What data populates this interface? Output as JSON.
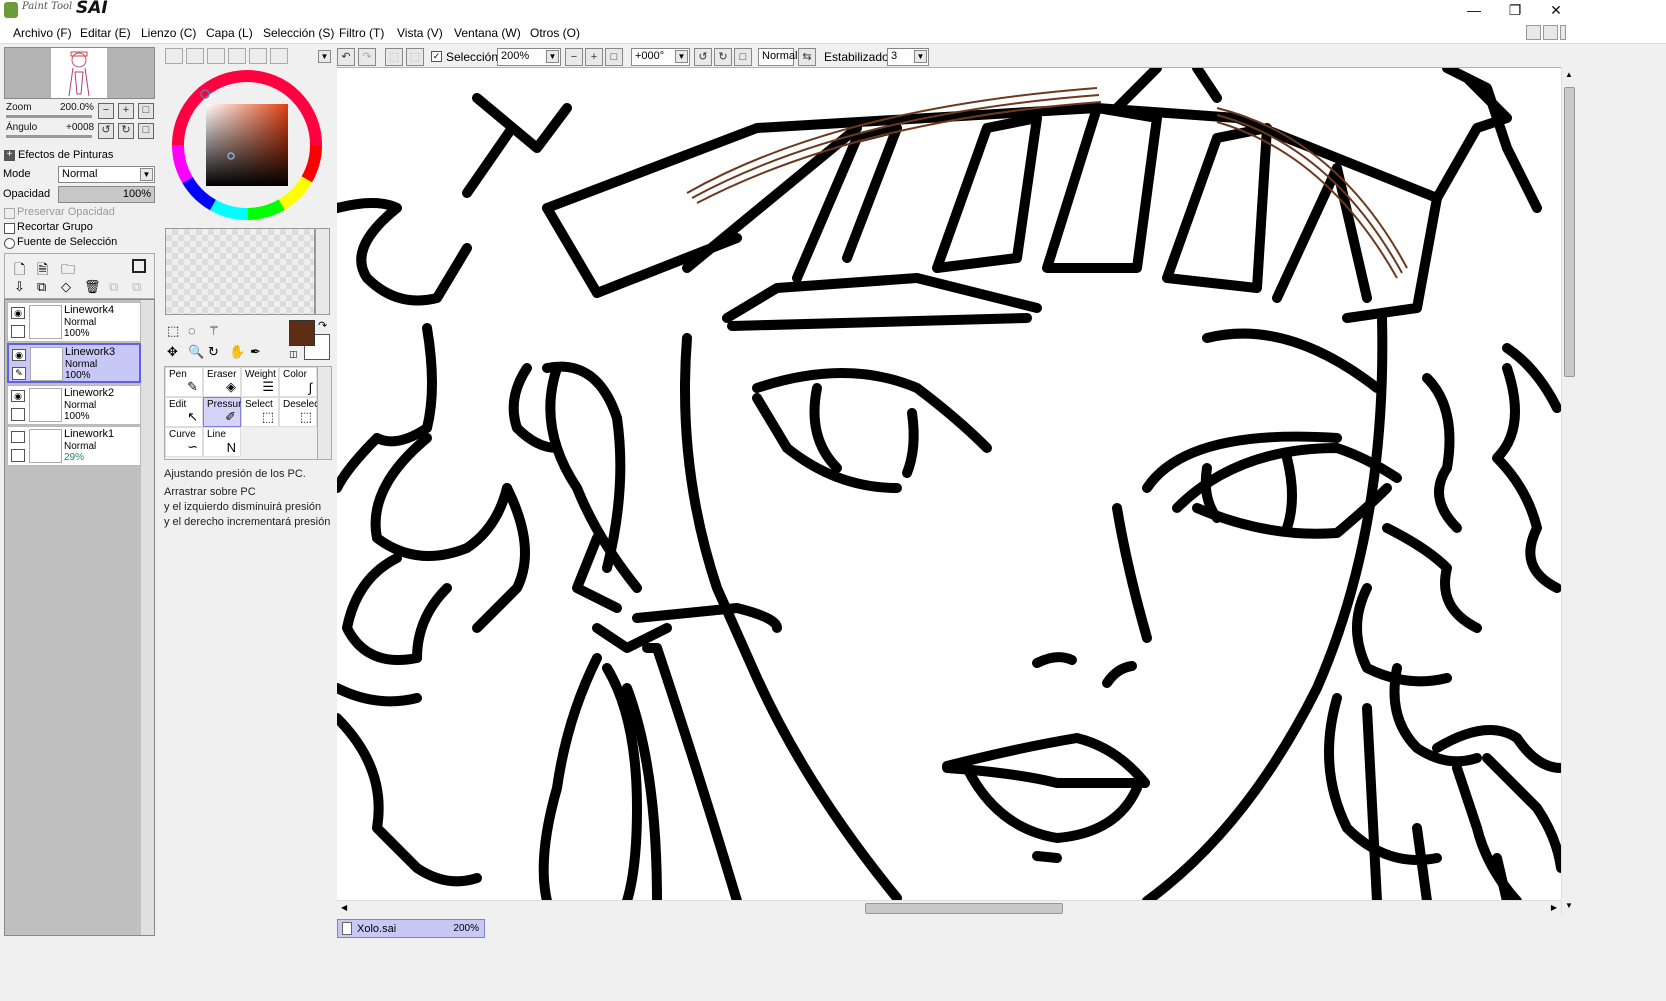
{
  "app": {
    "logo_small": "Paint Tool",
    "logo_big": "SAI"
  },
  "window_controls": {
    "minimize": "—",
    "restore": "❐",
    "close": "✕"
  },
  "menu": [
    "Archivo (F)",
    "Editar (E)",
    "Lienzo (C)",
    "Capa (L)",
    "Selección (S)",
    "Filtro (T)",
    "Vista (V)",
    "Ventana (W)",
    "Otros (O)"
  ],
  "navigator": {
    "zoom_label": "Zoom",
    "zoom_value": "200.0%",
    "angle_label": "Ángulo",
    "angle_value": "+0008"
  },
  "layer_props": {
    "effects_label": "Efectos de Pinturas",
    "mode_label": "Mode",
    "mode_value": "Normal",
    "opacity_label": "Opacidad",
    "opacity_value": "100%",
    "preserve_opacity": "Preservar Opacidad",
    "clip_group": "Recortar Grupo",
    "selection_source": "Fuente de Selección"
  },
  "layers": [
    {
      "name": "Linework4",
      "mode": "Normal",
      "opacity": "100%",
      "visible": true,
      "selected": false
    },
    {
      "name": "Linework3",
      "mode": "Normal",
      "opacity": "100%",
      "visible": true,
      "selected": true
    },
    {
      "name": "Linework2",
      "mode": "Normal",
      "opacity": "100%",
      "visible": true,
      "selected": false
    },
    {
      "name": "Linework1",
      "mode": "Normal",
      "opacity": "29%",
      "visible": false,
      "selected": false
    }
  ],
  "colors": {
    "primary": "#5c2e14",
    "secondary": "#ffffff",
    "accent_sel": "#c8c8f6",
    "canvas_border": "#f0a070",
    "stroke_brown": "#6b3a1e"
  },
  "tools": [
    {
      "label": "Pen",
      "icon": "✎"
    },
    {
      "label": "Eraser",
      "icon": "◈"
    },
    {
      "label": "Weight",
      "icon": "☰"
    },
    {
      "label": "Color",
      "icon": "∫"
    },
    {
      "label": "Edit",
      "icon": "↖"
    },
    {
      "label": "Pressure",
      "icon": "✐"
    },
    {
      "label": "Select",
      "icon": "⬚"
    },
    {
      "label": "Deselect",
      "icon": "⬚"
    },
    {
      "label": "Curve",
      "icon": "∽"
    },
    {
      "label": "Line",
      "icon": "N"
    }
  ],
  "selected_tool": "Pressure",
  "help": {
    "title": "Ajustando presión de los PC.",
    "line1": "Arrastrar sobre PC",
    "line2": "y el izquierdo disminuirá presión",
    "line3": "y el derecho incrementará presión"
  },
  "canvas_toolbar": {
    "selection_label": "Selección",
    "zoom": "200%",
    "angle": "+000°",
    "blend": "Normal",
    "stabilizer_label": "Estabilizador",
    "stabilizer_value": "3"
  },
  "document_tab": {
    "name": "Xolo.sai",
    "zoom": "200%"
  }
}
